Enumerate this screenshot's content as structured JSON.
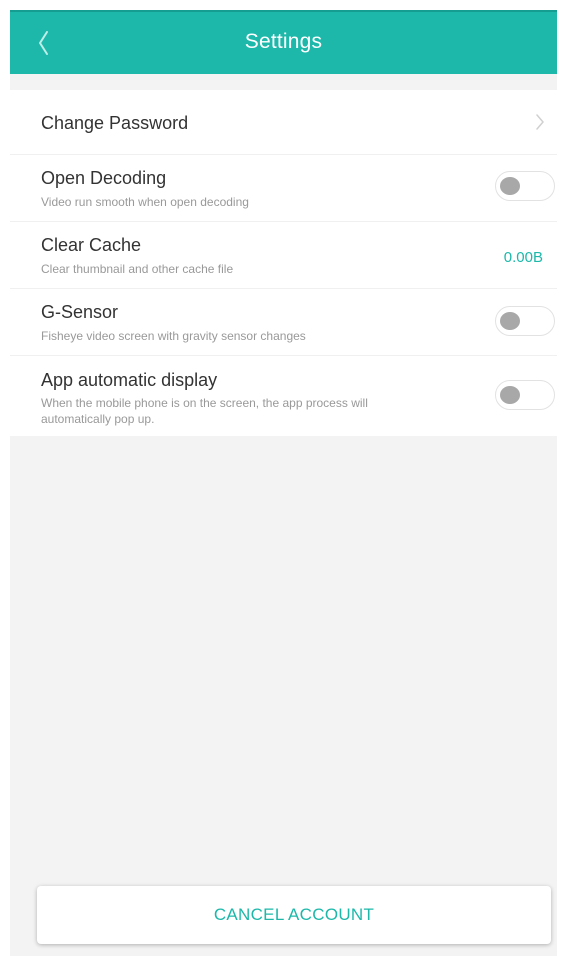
{
  "header": {
    "title": "Settings",
    "back_icon": "chevron-left-icon"
  },
  "settings": {
    "change_password": {
      "title": "Change Password",
      "icon": "chevron-right-icon"
    },
    "open_decoding": {
      "title": "Open Decoding",
      "subtitle": "Video run smooth when open decoding",
      "enabled": false
    },
    "clear_cache": {
      "title": "Clear Cache",
      "subtitle": "Clear thumbnail and other cache file",
      "value": "0.00B"
    },
    "g_sensor": {
      "title": "G-Sensor",
      "subtitle": "Fisheye video screen with gravity sensor changes",
      "enabled": false
    },
    "app_auto_display": {
      "title": "App automatic display",
      "subtitle": "When the mobile phone is on the screen, the app process will automatically pop up.",
      "enabled": false
    }
  },
  "footer": {
    "cancel_account_label": "CANCEL ACCOUNT"
  },
  "colors": {
    "accent": "#1db8aa",
    "background": "#f3f3f3",
    "toggle_off_knob": "#a8a8a8"
  }
}
